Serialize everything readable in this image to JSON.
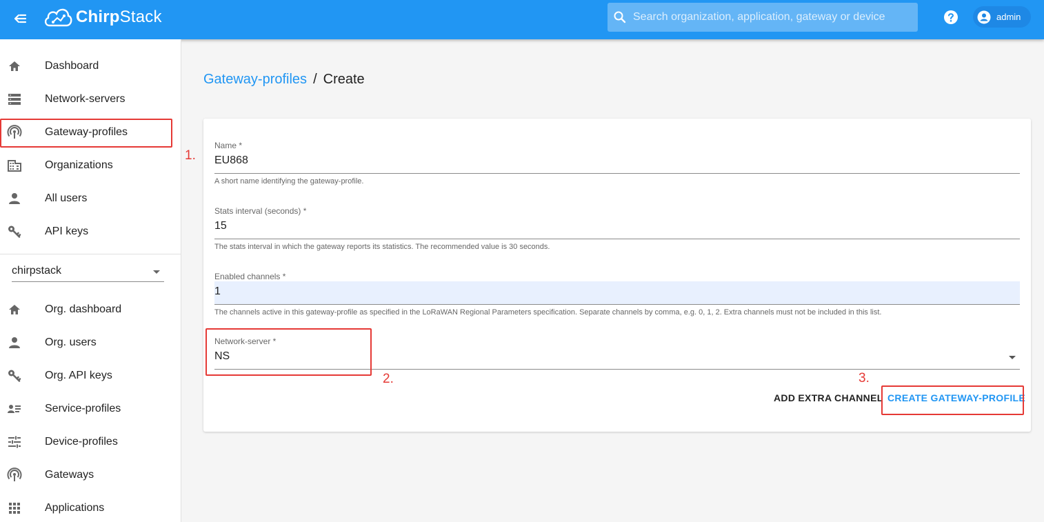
{
  "header": {
    "logo_bold": "Chirp",
    "logo_rest": "Stack",
    "search_placeholder": "Search organization, application, gateway or device",
    "user_label": "admin",
    "colors": {
      "primary": "#2196f3",
      "search_bg": "#64b5f6",
      "annotation": "#e53935"
    }
  },
  "sidebar": {
    "admin_items": [
      {
        "label": "Dashboard",
        "icon": "home-icon"
      },
      {
        "label": "Network-servers",
        "icon": "server-icon"
      },
      {
        "label": "Gateway-profiles",
        "icon": "gateway-icon"
      },
      {
        "label": "Organizations",
        "icon": "building-icon"
      },
      {
        "label": "All users",
        "icon": "person-icon"
      },
      {
        "label": "API keys",
        "icon": "key-icon"
      }
    ],
    "org_select_value": "chirpstack",
    "org_items": [
      {
        "label": "Org. dashboard",
        "icon": "home-icon"
      },
      {
        "label": "Org. users",
        "icon": "person-icon"
      },
      {
        "label": "Org. API keys",
        "icon": "key-icon"
      },
      {
        "label": "Service-profiles",
        "icon": "service-profile-icon"
      },
      {
        "label": "Device-profiles",
        "icon": "tune-icon"
      },
      {
        "label": "Gateways",
        "icon": "gateway-icon"
      },
      {
        "label": "Applications",
        "icon": "apps-grid-icon"
      }
    ]
  },
  "breadcrumb": {
    "link": "Gateway-profiles",
    "separator": "/",
    "current": "Create"
  },
  "form": {
    "name": {
      "label": "Name *",
      "value": "EU868",
      "help": "A short name identifying the gateway-profile."
    },
    "stats_interval": {
      "label": "Stats interval (seconds) *",
      "value": "15",
      "help": "The stats interval in which the gateway reports its statistics. The recommended value is 30 seconds."
    },
    "enabled_channels": {
      "label": "Enabled channels *",
      "value": "1",
      "help": "The channels active in this gateway-profile as specified in the LoRaWAN Regional Parameters specification. Separate channels by comma, e.g. 0, 1, 2. Extra channels must not be included in this list."
    },
    "network_server": {
      "label": "Network-server *",
      "value": "NS"
    },
    "add_extra_channel_label": "ADD EXTRA CHANNEL",
    "create_label": "CREATE GATEWAY-PROFILE"
  },
  "annotations": [
    "1.",
    "2.",
    "3."
  ]
}
